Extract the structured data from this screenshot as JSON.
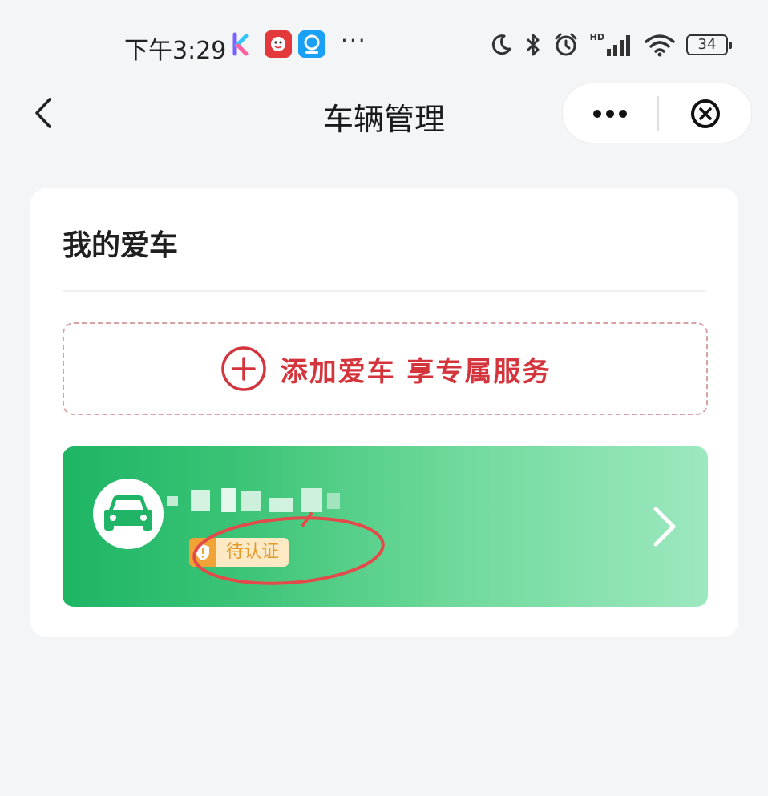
{
  "status_bar": {
    "time": "下午3:29",
    "more": "···",
    "network": "HD",
    "battery": "34",
    "icons": [
      "moon-icon",
      "bluetooth-icon",
      "alarm-icon",
      "signal-icon",
      "wifi-icon",
      "battery-icon"
    ]
  },
  "nav": {
    "title": "车辆管理",
    "icons": [
      "back-chevron-icon",
      "more-dots-icon",
      "close-circle-icon"
    ]
  },
  "card": {
    "title": "我的爱车",
    "add_car_label": "添加爱车 享专属服务",
    "vehicle": {
      "status_label": "待认证"
    }
  },
  "colors": {
    "accent_red": "#d4343c",
    "green_start": "#1db564",
    "green_end": "#9de8c0",
    "badge_orange": "#f0a437",
    "badge_bg": "#fde9c4"
  }
}
